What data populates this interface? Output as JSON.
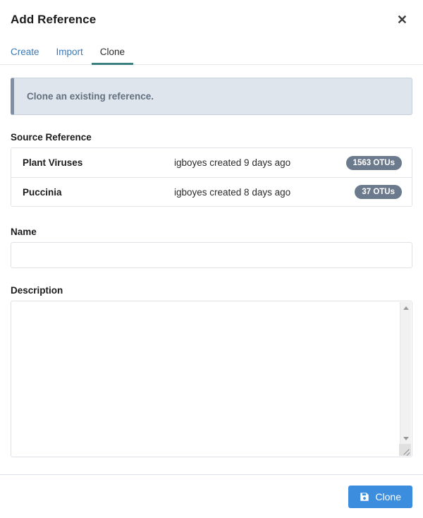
{
  "dialog": {
    "title": "Add Reference",
    "close_icon": "close-icon"
  },
  "tabs": [
    {
      "label": "Create",
      "active": false
    },
    {
      "label": "Import",
      "active": false
    },
    {
      "label": "Clone",
      "active": true
    }
  ],
  "alert": {
    "text": "Clone an existing reference."
  },
  "source_reference": {
    "label": "Source Reference",
    "items": [
      {
        "name": "Plant Viruses",
        "meta": "igboyes created 9 days ago",
        "badge": "1563 OTUs"
      },
      {
        "name": "Puccinia",
        "meta": "igboyes created 8 days ago",
        "badge": "37 OTUs"
      }
    ]
  },
  "name_field": {
    "label": "Name",
    "value": "",
    "placeholder": ""
  },
  "description_field": {
    "label": "Description",
    "value": "",
    "placeholder": ""
  },
  "footer": {
    "submit_label": "Clone",
    "submit_icon": "save-icon"
  },
  "colors": {
    "accent_tab": "#3c7f80",
    "link": "#3b77b5",
    "primary_button": "#3c8dde",
    "badge": "#6c7a8d",
    "alert_bg": "#dfe5ed",
    "alert_bar": "#7f8fa6"
  }
}
